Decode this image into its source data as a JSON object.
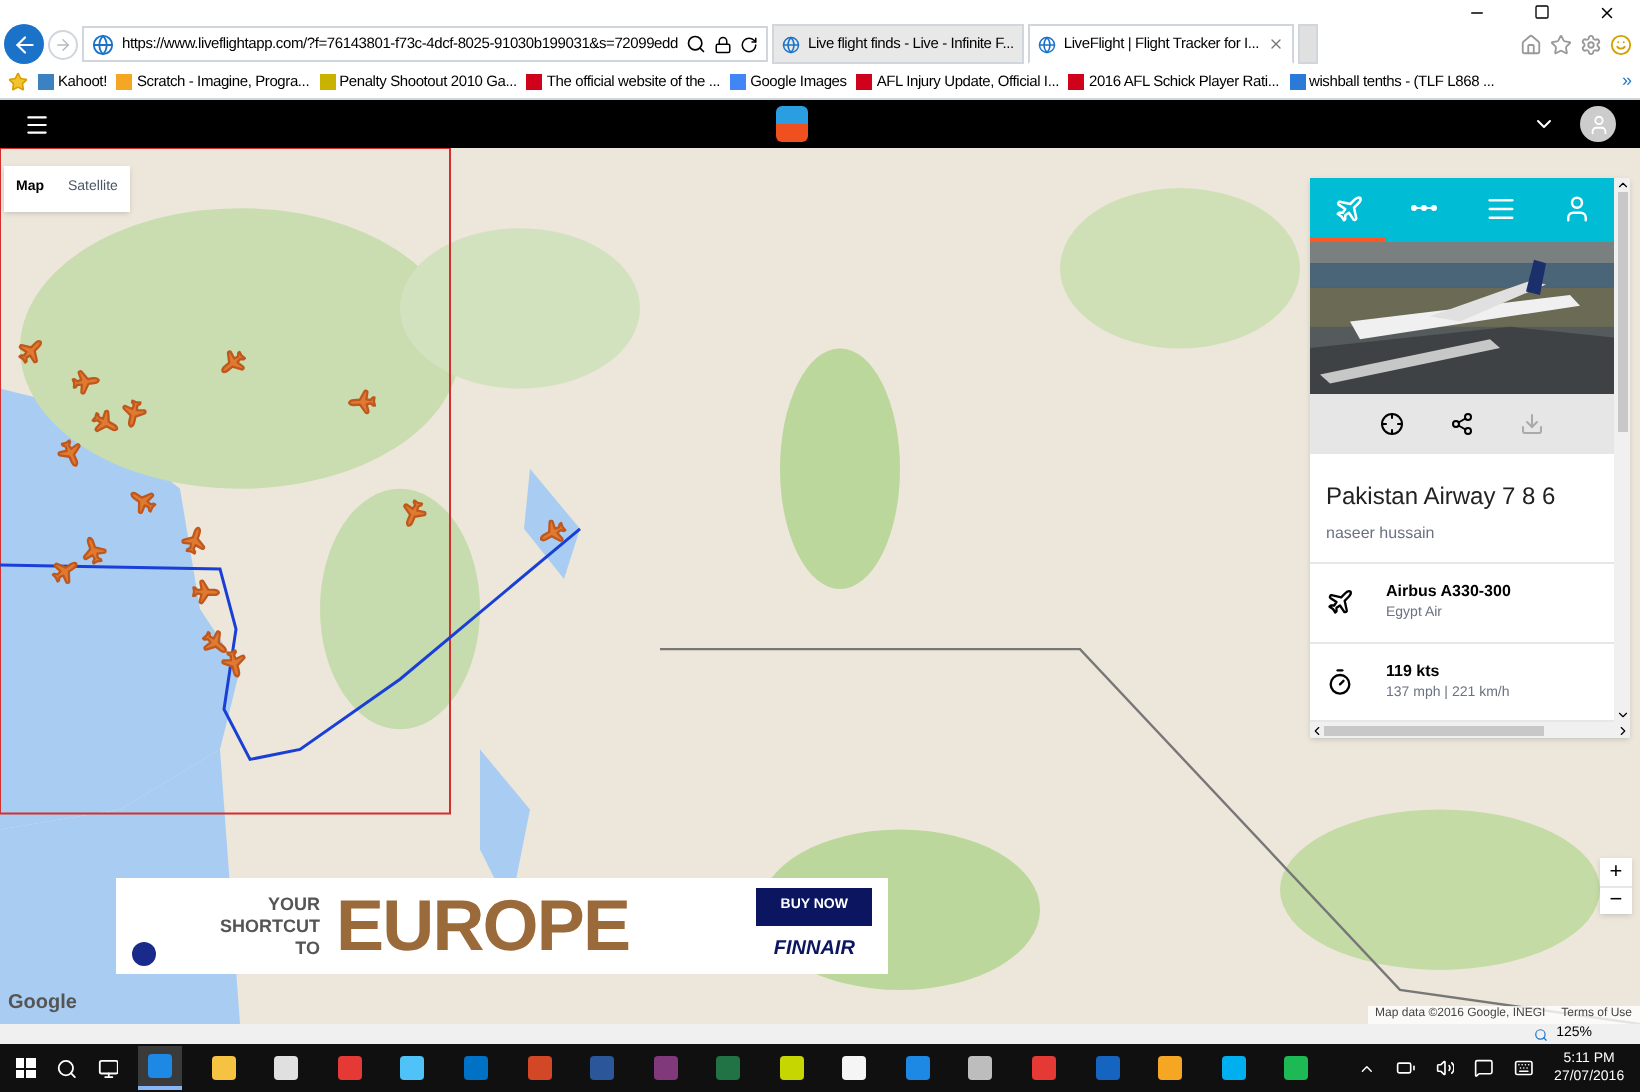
{
  "browser": {
    "address": "https://www.liveflightapp.com/?f=76143801-f73c-4dcf-8025-91030b199031&s=72099edd",
    "tabs": [
      {
        "title": "Live flight finds - Live - Infinite F...",
        "selected": false
      },
      {
        "title": "LiveFlight | Flight Tracker for I...",
        "selected": true
      }
    ],
    "favorites": [
      {
        "label": "Kahoot!",
        "color": "#3b82c4"
      },
      {
        "label": "Scratch - Imagine, Progra...",
        "color": "#f5a623"
      },
      {
        "label": "Penalty Shootout 2010 Ga...",
        "color": "#c8b400"
      },
      {
        "label": "The official website of the ...",
        "color": "#d0021b"
      },
      {
        "label": "Google Images",
        "color": "#4285f4"
      },
      {
        "label": "AFL Injury Update, Official I...",
        "color": "#d0021b"
      },
      {
        "label": "2016 AFL Schick Player Rati...",
        "color": "#d0021b"
      },
      {
        "label": "wishball tenths - (TLF L868 ...",
        "color": "#2a7ad8"
      }
    ],
    "more": "»",
    "zoom": "125%"
  },
  "map": {
    "types": [
      {
        "label": "Map",
        "selected": true
      },
      {
        "label": "Satellite",
        "selected": false
      }
    ],
    "google": "Google",
    "attribution": "Map data ©2016 Google, INEGI",
    "terms": "Terms of Use",
    "zoom_in": "+",
    "zoom_out": "−"
  },
  "panel": {
    "tabs": [
      {
        "kind": "plane",
        "selected": true
      },
      {
        "kind": "route",
        "selected": false
      },
      {
        "kind": "list",
        "selected": false
      },
      {
        "kind": "user",
        "selected": false
      }
    ],
    "title": "Pakistan Airway 7 8 6",
    "user": "naseer hussain",
    "details": [
      {
        "kind": "plane",
        "primary": "Airbus A330-300",
        "secondary": "Egypt Air"
      },
      {
        "kind": "speed",
        "primary": "119 kts",
        "secondary": "137 mph | 221 km/h"
      }
    ]
  },
  "ad": {
    "lines": [
      "YOUR",
      "SHORTCUT",
      "TO"
    ],
    "headline": "EUROPE",
    "button": "BUY NOW",
    "brand": "FINNAIR"
  },
  "taskbar": {
    "apps": [
      {
        "color": "#1e88e5",
        "selected": true
      },
      {
        "color": "#f5c242",
        "selected": false
      },
      {
        "color": "#e0e0e0",
        "selected": false
      },
      {
        "color": "#e53935",
        "selected": false
      },
      {
        "color": "#4fc3f7",
        "selected": false
      },
      {
        "color": "#0072c6",
        "selected": false
      },
      {
        "color": "#d24726",
        "selected": false
      },
      {
        "color": "#2b579a",
        "selected": false
      },
      {
        "color": "#80397b",
        "selected": false
      },
      {
        "color": "#217346",
        "selected": false
      },
      {
        "color": "#c6d600",
        "selected": false
      },
      {
        "color": "#f5f5f5",
        "selected": false
      },
      {
        "color": "#1e88e5",
        "selected": false
      },
      {
        "color": "#bdbdbd",
        "selected": false
      },
      {
        "color": "#e53935",
        "selected": false
      },
      {
        "color": "#1565c0",
        "selected": false
      },
      {
        "color": "#f5a623",
        "selected": false
      },
      {
        "color": "#00aff0",
        "selected": false
      },
      {
        "color": "#1db954",
        "selected": false
      }
    ],
    "time": "5:11 PM",
    "date": "27/07/2016"
  }
}
